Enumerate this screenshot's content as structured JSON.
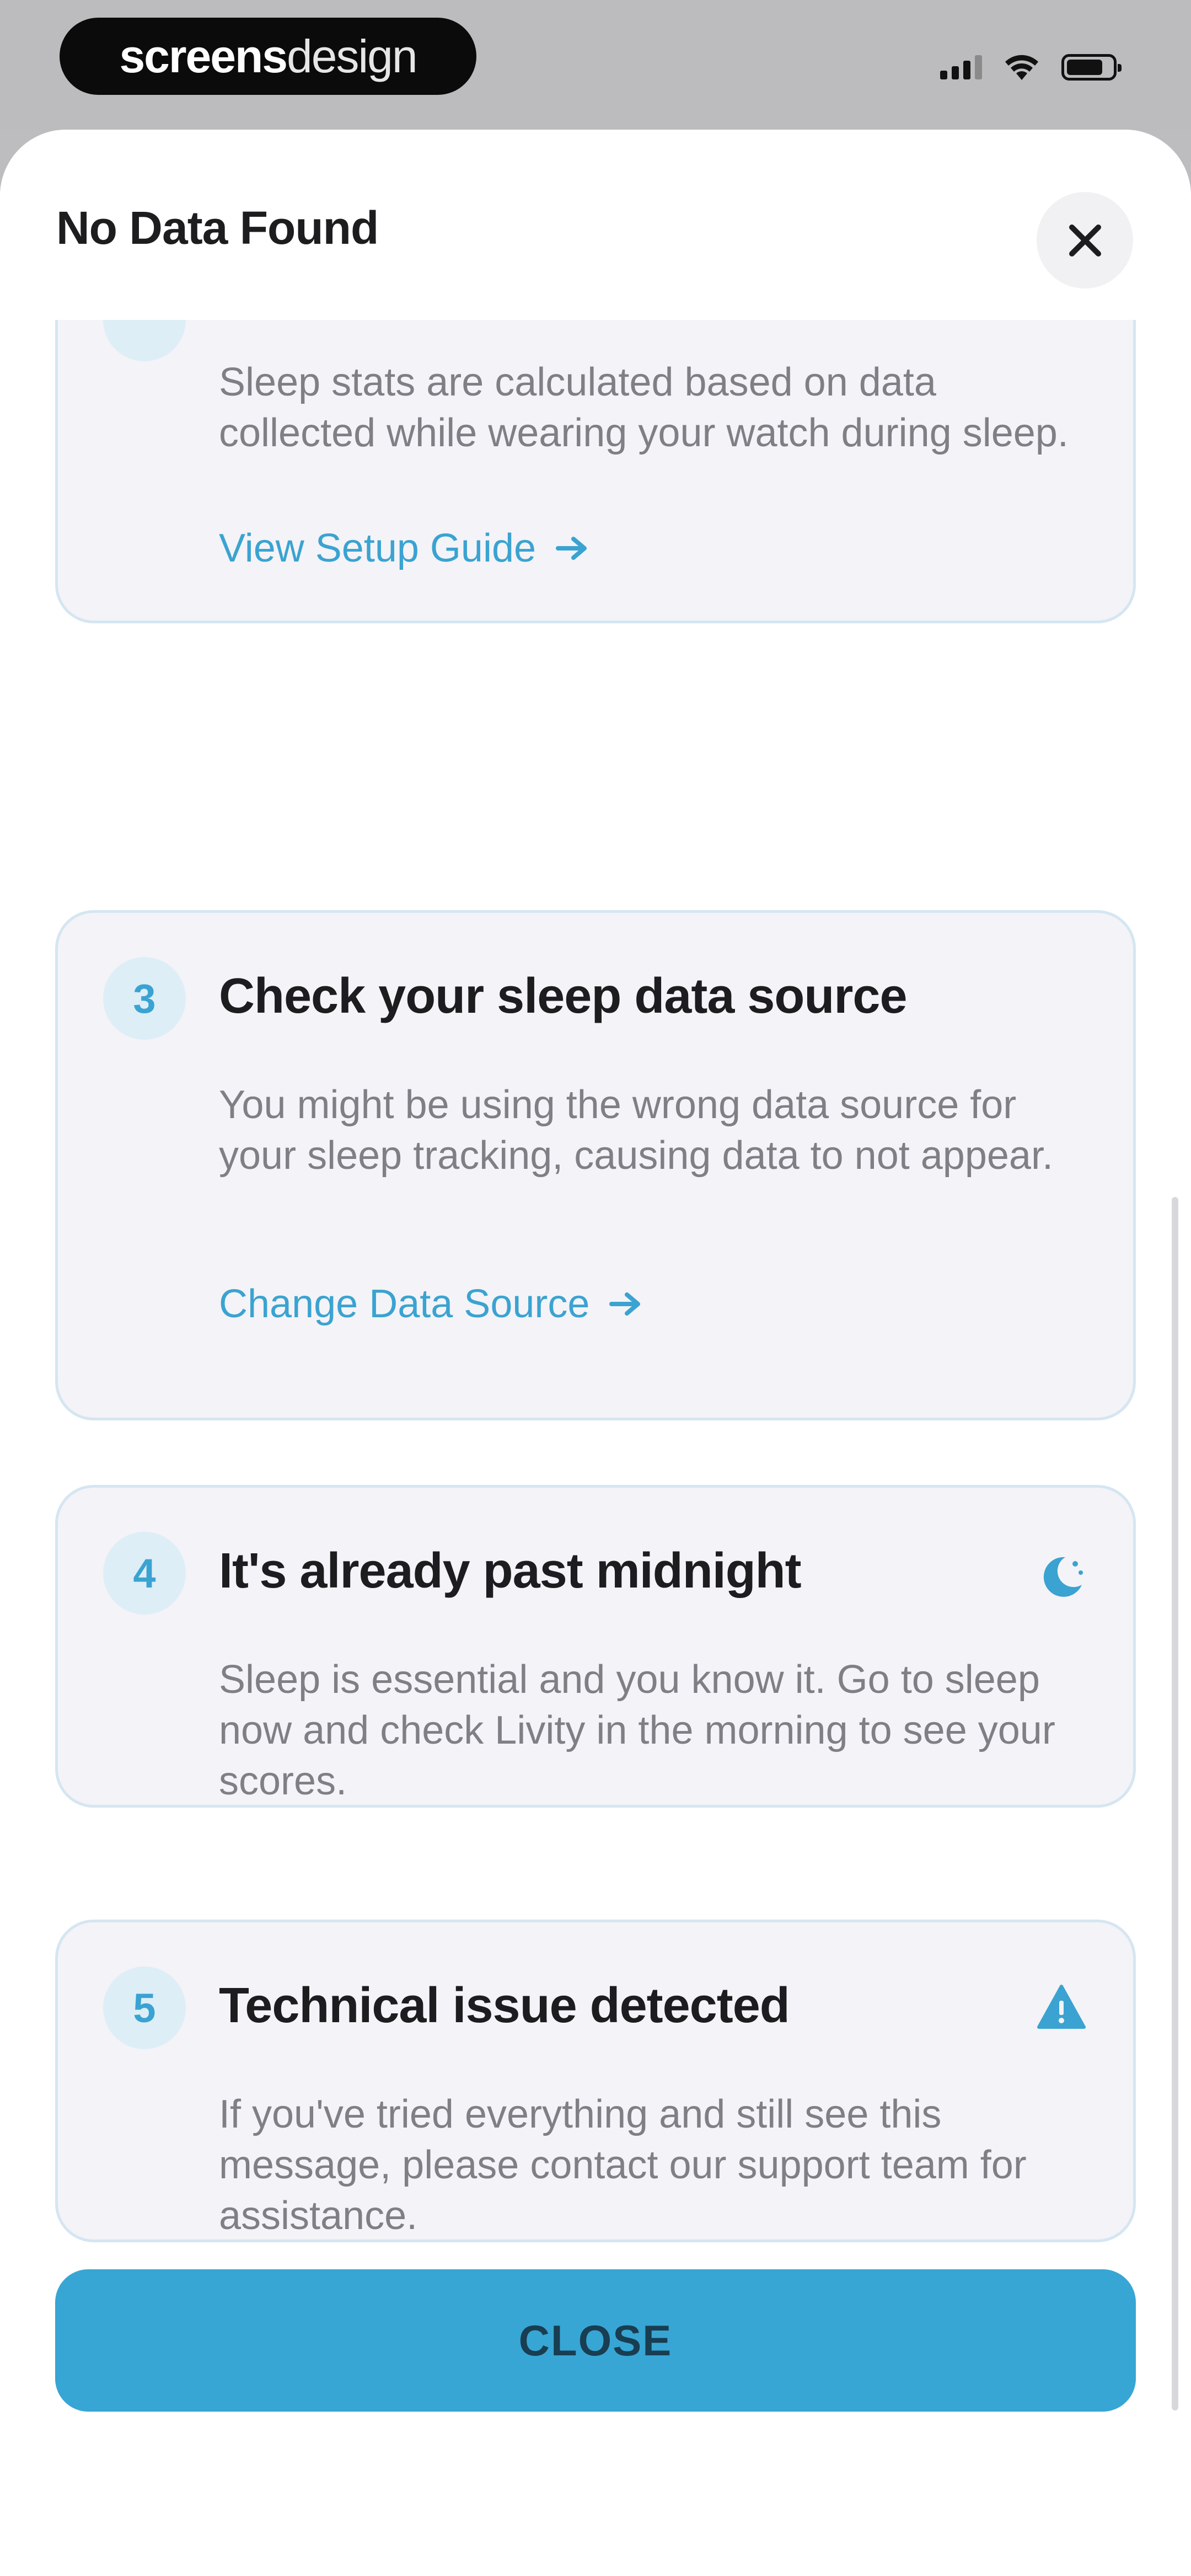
{
  "status_bar": {
    "brand_part1": "screens",
    "brand_part2": "design"
  },
  "sheet": {
    "title": "No Data Found",
    "close_icon": "close-icon"
  },
  "cards": [
    {
      "number": "",
      "title": "",
      "description": "Sleep stats are calculated based on data collected while wearing your watch during sleep.",
      "link": "View Setup Guide"
    },
    {
      "number": "3",
      "title": "Check your sleep data source",
      "description": "You might be using the wrong data source for your sleep tracking, causing data to not appear.",
      "link": "Change Data Source"
    },
    {
      "number": "4",
      "title": "It's already past midnight",
      "description": "Sleep is essential and you know it. Go to sleep now and check Livity in the morning to see your scores.",
      "icon": "moon-icon"
    },
    {
      "number": "5",
      "title": "Technical issue detected",
      "description": "If you've tried everything and still see this message, please contact our support team for assistance.",
      "icon": "warning-icon"
    }
  ],
  "footer": {
    "close_label": "CLOSE"
  },
  "colors": {
    "accent": "#37a6d4",
    "card_bg": "#f4f3f7",
    "card_border": "#d5e6f1"
  }
}
